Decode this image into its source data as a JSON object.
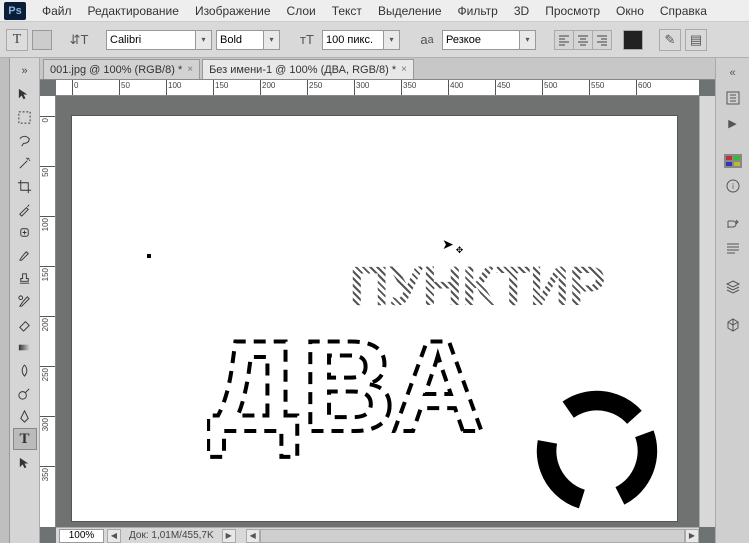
{
  "app": {
    "logo": "Ps"
  },
  "menu": {
    "file": "Файл",
    "edit": "Редактирование",
    "image": "Изображение",
    "layer": "Слои",
    "type": "Текст",
    "select": "Выделение",
    "filter": "Фильтр",
    "threeD": "3D",
    "view": "Просмотр",
    "window": "Окно",
    "help": "Справка"
  },
  "options": {
    "font_family": "Calibri",
    "font_style": "Bold",
    "font_size": "100 пикс.",
    "antialias": "Резкое"
  },
  "tabs": [
    {
      "label": "001.jpg @ 100% (RGB/8) *"
    },
    {
      "label": "Без имени-1 @ 100% (ДВА, RGB/8) *"
    }
  ],
  "ruler_h": [
    "0",
    "50",
    "100",
    "150",
    "200",
    "250",
    "300",
    "350",
    "400",
    "450",
    "500",
    "550",
    "600"
  ],
  "ruler_v": [
    "0",
    "50",
    "100",
    "150",
    "200",
    "250",
    "300",
    "350"
  ],
  "status": {
    "zoom": "100%",
    "docinfo": "Док: 1,01M/455,7K"
  },
  "canvas": {
    "text_punk": "ПУНКТИР",
    "text_dva": "ДВА"
  }
}
